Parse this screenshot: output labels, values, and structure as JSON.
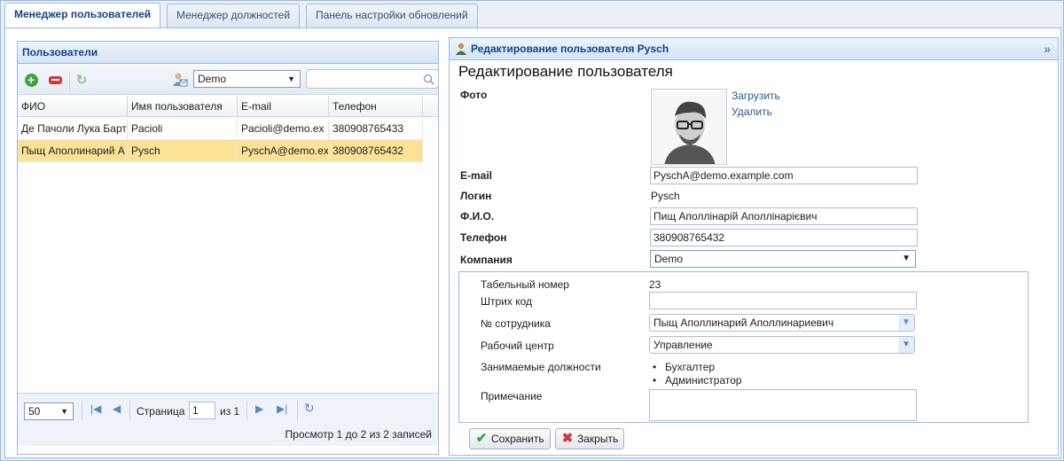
{
  "tabs": [
    {
      "label": "Менеджер пользователей",
      "active": true
    },
    {
      "label": "Менеджер должностей",
      "active": false
    },
    {
      "label": "Панель настройки обновлений",
      "active": false
    }
  ],
  "users_panel": {
    "title": "Пользователи",
    "company_filter": "Demo",
    "search_placeholder": "",
    "columns": [
      "ФИО",
      "Имя пользователя",
      "E-mail",
      "Телефон"
    ],
    "rows": [
      {
        "fio": "Де Пачоли Лука Барт",
        "username": "Pacioli",
        "email": "Pacioli@demo.ex",
        "phone": "380908765433",
        "selected": false
      },
      {
        "fio": "Пыщ Аполлинарий А",
        "username": "Pysch",
        "email": "PyschA@demo.ex",
        "phone": "380908765432",
        "selected": true
      }
    ],
    "pager": {
      "page_size": "50",
      "page_label": "Страница",
      "page_value": "1",
      "of_label": "из 1",
      "summary": "Просмотр 1 до 2 из 2 записей"
    }
  },
  "edit_panel": {
    "title": "Редактирование пользователя Pysch",
    "heading": "Редактирование пользователя",
    "photo_label": "Фото",
    "upload_link": "Загрузить",
    "delete_link": "Удалить",
    "email_label": "E-mail",
    "email_value": "PyschA@demo.example.com",
    "login_label": "Логин",
    "login_value": "Pysch",
    "fio_label": "Ф.И.О.",
    "fio_value": "Пищ Аполлінарій Аполлінарієвич",
    "phone_label": "Телефон",
    "phone_value": "380908765432",
    "company_label": "Компания",
    "company_value": "Demo",
    "tab_number_label": "Табельный номер",
    "tab_number_value": "23",
    "barcode_label": "Штрих код",
    "barcode_value": "",
    "employee_label": "№ сотрудника",
    "employee_value": "Пыщ Аполлинарий Аполлинариевич",
    "workcenter_label": "Рабочий центр",
    "workcenter_value": "Управление",
    "positions_label": "Занимаемые должности",
    "positions": [
      "Бухгалтер",
      "Администратор"
    ],
    "note_label": "Примечание",
    "note_value": "",
    "save_label": "Сохранить",
    "close_label": "Закрыть"
  },
  "colors": {
    "accent": "#15428b",
    "selected_row": "#fbe296",
    "border": "#99bbe8"
  }
}
